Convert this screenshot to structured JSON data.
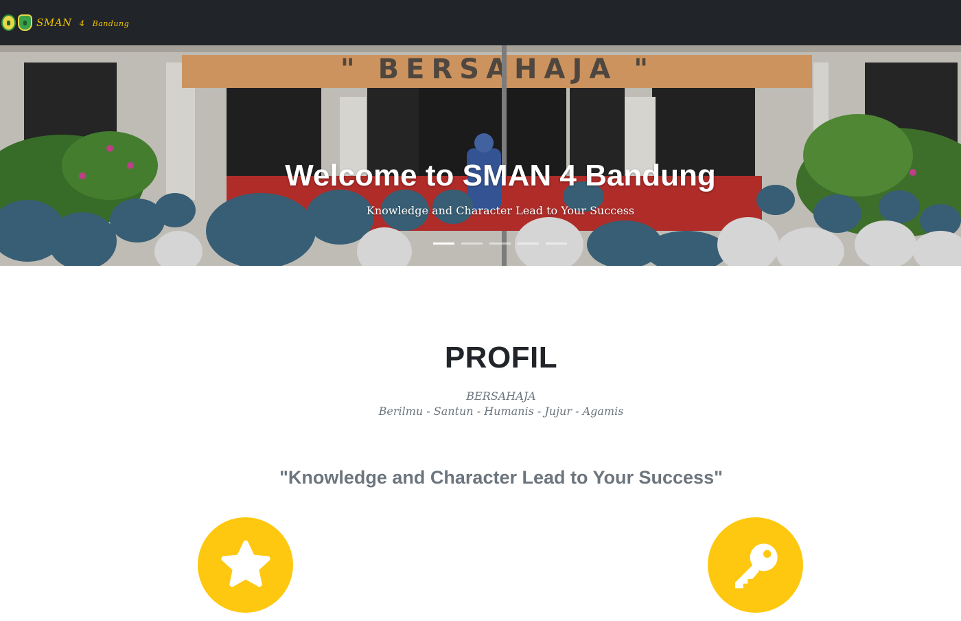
{
  "navbar": {
    "brand_text": "SMAN",
    "brand_number": "4",
    "brand_city": "Bandung",
    "logo_icons": [
      "school-emblem-icon",
      "province-emblem-icon"
    ]
  },
  "hero": {
    "banner_text": "\" BERSAHAJA \"",
    "title": "Welcome to SMAN 4 Bandung",
    "subtitle": "Knowledge and Character Lead to Your Success",
    "slides_count": 5,
    "active_slide": 1
  },
  "profil": {
    "title": "PROFIL",
    "motto_word": "BERSAHAJA",
    "motto_values": "Berilmu - Santun - Humanis - Jujur - Agamis",
    "quote": "\"Knowledge and Character Lead to Your Success\"",
    "features": [
      {
        "icon": "star-icon"
      },
      {
        "icon": "key-icon"
      }
    ]
  },
  "colors": {
    "navbar_bg": "#212529",
    "accent": "#fec810",
    "heading": "#212529",
    "muted": "#6c757d"
  }
}
